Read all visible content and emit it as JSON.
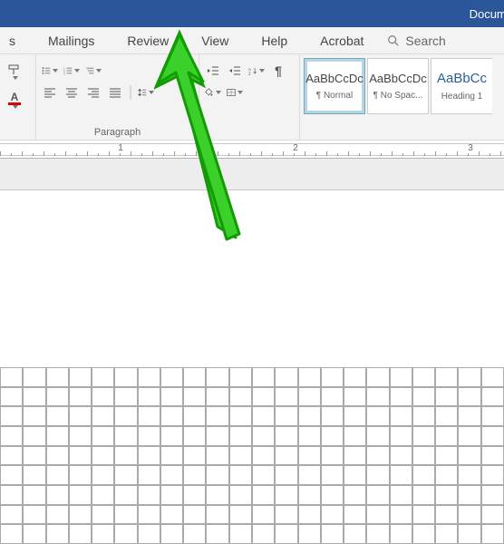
{
  "titlebar": {
    "doc_title": "Docume"
  },
  "tabs": {
    "mailings": "Mailings",
    "review": "Review",
    "view": "View",
    "help": "Help",
    "acrobat": "Acrobat"
  },
  "search": {
    "label": "Search"
  },
  "ribbon": {
    "paragraph_label": "Paragraph"
  },
  "styles": {
    "normal": {
      "preview": "AaBbCcDc",
      "name": "¶ Normal"
    },
    "nospacing": {
      "preview": "AaBbCcDc",
      "name": "¶ No Spac..."
    },
    "heading1": {
      "preview": "AaBbCc",
      "name": "Heading 1"
    }
  },
  "ruler": {
    "marks": [
      "1",
      "2",
      "3"
    ]
  }
}
